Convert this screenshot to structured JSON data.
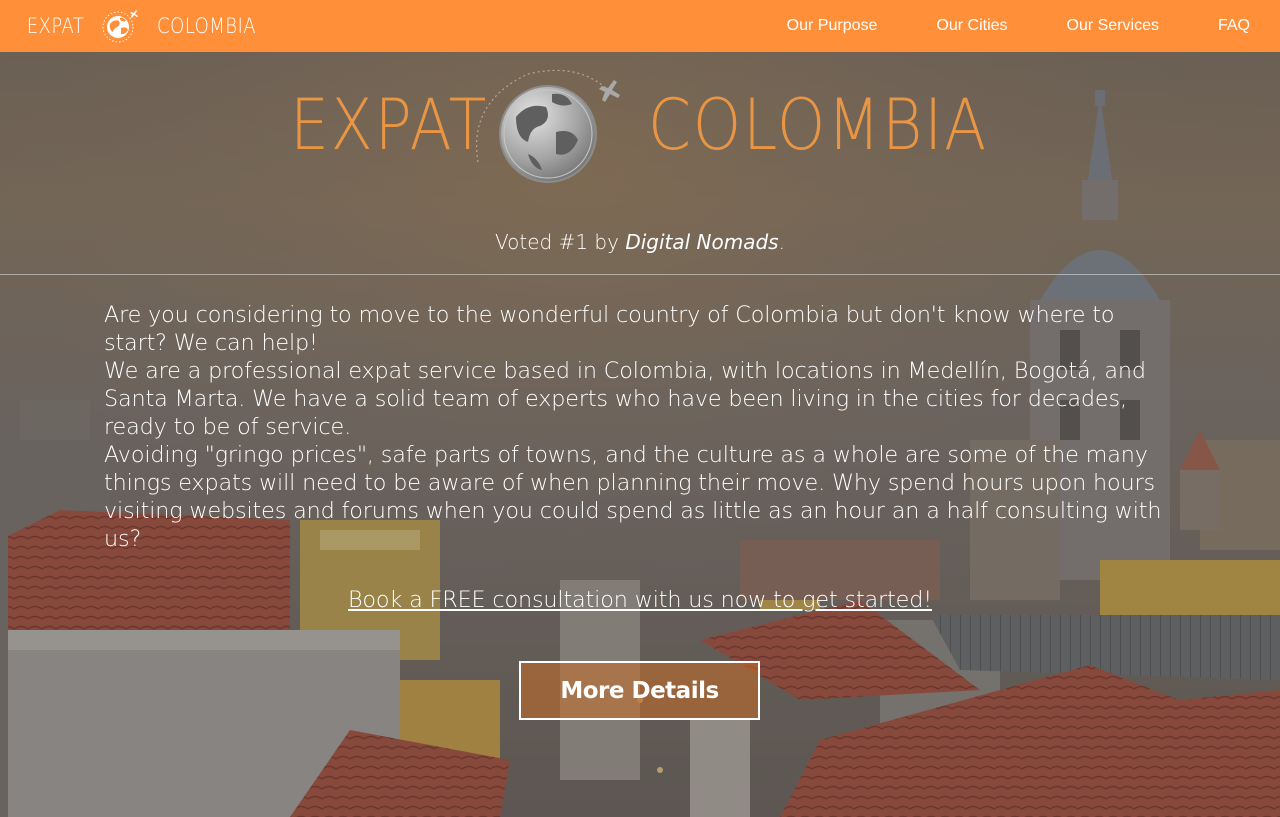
{
  "nav": {
    "brand_left": "EXPAT",
    "brand_right": "COLOMBIA",
    "links": [
      {
        "label": "Our Purpose"
      },
      {
        "label": "Our Cities"
      },
      {
        "label": "Our Services"
      },
      {
        "label": "FAQ"
      }
    ]
  },
  "hero": {
    "logo_left": "EXPAT",
    "logo_right": "COLOMBIA",
    "tagline_prefix": "Voted #1 by ",
    "tagline_emph": "Digital Nomads",
    "tagline_suffix": ".",
    "paragraphs": [
      "Are you considering to move to the wonderful country of Colombia but don't know where to start? We can help!",
      "We are a professional expat service based in Colombia, with locations in Medellín, Bogotá, and Santa Marta. We have a solid team of experts who have been living in the cities for decades, ready to be of service.",
      "Avoiding \"gringo prices\", safe parts of towns, and the culture as a whole are some of the many things expats will need to be aware of when planning their move. Why spend hours upon hours visiting websites and forums when you could spend as little as an hour an a half consulting with us?"
    ],
    "cta_link": "Book a FREE consultation with us now to get started!",
    "more_button": "More Details"
  },
  "colors": {
    "nav_bg": "#ff8f38",
    "logo_orange": "#f39a43",
    "text": "#ffffff"
  },
  "icons": [
    "globe-airplane-icon"
  ]
}
